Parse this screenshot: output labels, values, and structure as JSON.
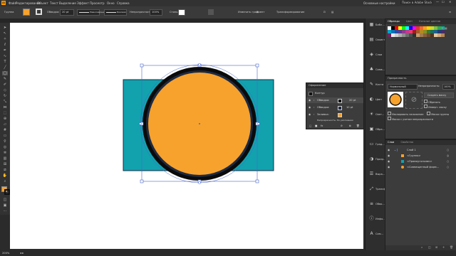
{
  "menu": {
    "items": [
      "Файл",
      "Редактирование",
      "Объект",
      "Текст",
      "Выделение",
      "Эффект",
      "Просмотр",
      "Окно",
      "Справка"
    ],
    "workspace": "Основные настройки",
    "search": "Поиск в Adobe Stock"
  },
  "control_bar": {
    "object_type": "Группа",
    "fill_color": "#f7a22d",
    "stroke_label": "Обводка:",
    "stroke_weight": "20 pt",
    "profile": "Равномерный",
    "brush": "Базовая",
    "opacity_label": "Непрозрачность:",
    "opacity_value": "100%",
    "style_label": "Стиль:",
    "recolor": "Изменить градиент",
    "transform": "Трансформирование"
  },
  "appearance": {
    "title": "Оформление",
    "object": "Контур",
    "rows": [
      {
        "label": "Обводка:",
        "value": "20 pt"
      },
      {
        "label": "Обводка:",
        "value": "10 pt"
      },
      {
        "label": "Заливка:",
        "value": ""
      }
    ],
    "footer": "Непрозрачность: По умолчанию"
  },
  "dock": {
    "items": [
      "Библ...",
      "Своиства",
      "Слои",
      "Симв...",
      "Кисти",
      "Цвет",
      "Свет...",
      "Обра...",
      "Град...",
      "Прозр...",
      "Выра...",
      "Трансф...",
      "Обво...",
      "Инфо...",
      "Сим...",
      "Грео..."
    ]
  },
  "swatches": {
    "tabs": [
      "Образцы",
      "Цвет",
      "Каталог цветов"
    ]
  },
  "transparency": {
    "title": "Прозрачность",
    "mode": "Нормальный",
    "opacity_label": "Непрозрачность:",
    "opacity_value": "100%",
    "make_mask": "Создать маску",
    "clip": "Обрезать",
    "invert": "Инверт. маску",
    "isolate": "Изолировать наложение",
    "knockout": "Маска группы",
    "define": "Маска с учетом непрозрачности"
  },
  "layers": {
    "tabs": [
      "Слои",
      "Свойства"
    ],
    "items": [
      "Слой 1",
      "<Группа>",
      "<Прямоугольник>",
      "<Совмещенный форм..."
    ]
  },
  "status": {
    "zoom": "200%"
  },
  "colors": {
    "orange": "#f7a22d",
    "teal": "#11a2ae",
    "black": "#0a0a0a",
    "navy": "#1d2a44",
    "selection": "#4a67c9"
  },
  "swatch_colors": [
    "#ffffff",
    "#000000",
    "#ff0000",
    "#ffff00",
    "#00ff00",
    "#00ffff",
    "#0000ff",
    "#ff00ff",
    "#e8302f",
    "#f26a2c",
    "#f8a21b",
    "#fdd400",
    "#c7da2e",
    "#7ac142",
    "#2da94f",
    "#00a88f",
    "#00a3c7",
    "#0a72b8",
    "#2b4aa0",
    "#5b3991",
    "#8c3b8f",
    "#c23b8e",
    "#e83a6e",
    "#9c1f1f",
    "#a85a2a",
    "#b38a1f",
    "#8a8f24",
    "#3d7a2b",
    "#1b6e5c",
    "#1f5f8a",
    "#223b72",
    "#4a2a6b",
    "#6e2560",
    "#eaeaea",
    "#cfcfcf",
    "#b0b0b0",
    "#8f8f8f",
    "#6d6d6d",
    "#4d4d4d",
    "#2f2f2f",
    "#c69c6d",
    "#a37b4f",
    "#85603a",
    "#6b4a2b",
    "#4f351d",
    "#e5c7a1",
    "#cfa87c",
    "#b48655"
  ]
}
